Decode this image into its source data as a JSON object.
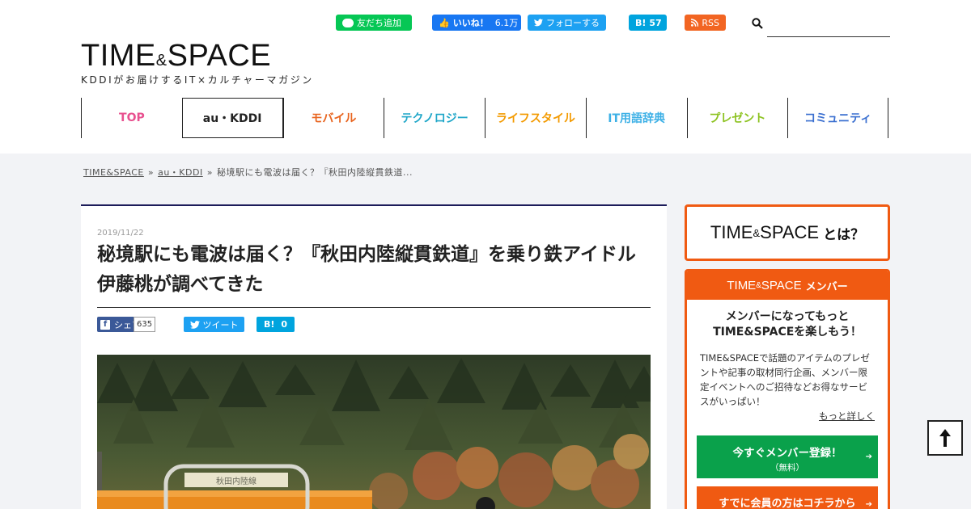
{
  "social": {
    "line": "友だち追加",
    "facebook_label": "いいね！",
    "facebook_count": "6.1万",
    "twitter": "フォローする",
    "hatena_label": "B!",
    "hatena_count": "57",
    "rss": "RSS"
  },
  "search": {
    "placeholder": "",
    "value": ""
  },
  "logo": {
    "left": "TIME",
    "amp": "&",
    "right": "SPACE",
    "tagline": "KDDIがお届けするIT×カルチャーマガジン"
  },
  "nav": [
    {
      "label": "TOP",
      "color": "#e8508f"
    },
    {
      "label": "au・KDDI",
      "color": "#222222"
    },
    {
      "label": "モバイル",
      "color": "#e8641e"
    },
    {
      "label": "テクノロジー",
      "color": "#1ea6c8"
    },
    {
      "label": "ライフスタイル",
      "color": "#f39a00"
    },
    {
      "label": "IT用語辞典",
      "color": "#3cb0e6"
    },
    {
      "label": "プレゼント",
      "color": "#8cc21f"
    },
    {
      "label": "コミュニティ",
      "color": "#3a6fd0"
    }
  ],
  "breadcrumb": {
    "home": "TIME&SPACE",
    "category": "au・KDDI",
    "current": "秘境駅にも電波は届く？『秋田内陸縦貫鉄道...",
    "separator": "»"
  },
  "article": {
    "date": "2019/11/22",
    "title": "秘境駅にも電波は届く？『秋田内陸縦貫鉄道』を乗り鉄アイドル伊藤桃が調べてきた",
    "share": {
      "fb_label": "シェア",
      "fb_count": "635",
      "tweet_label": "ツイート",
      "hatena_label": "B!",
      "hatena_count": "0"
    },
    "photo_sign": "秋田内陸線"
  },
  "sidebar": {
    "about": {
      "left": "TIME",
      "amp": "&",
      "right": "SPACE",
      "suffix": "とは？"
    },
    "member": {
      "head_left": "TIME",
      "head_amp": "&",
      "head_right": "SPACE",
      "head_suffix": "メンバー",
      "lead_line1": "メンバーになってもっと",
      "lead_line2": "TIME&SPACEを楽しもう！",
      "desc": "TIME&SPACEで話題のアイテムのプレゼントや記事の取材同行企画、メンバー限定イベントへのご招待などお得なサービスがいっぱい！",
      "more": "もっと詳しく",
      "register_main": "今すぐメンバー登録！",
      "register_sub": "（無料）",
      "login": "すでに会員の方はコチラから"
    }
  },
  "colors": {
    "accent": "#f05a12",
    "navy": "#1c1c5a",
    "green": "#0aa14b"
  }
}
